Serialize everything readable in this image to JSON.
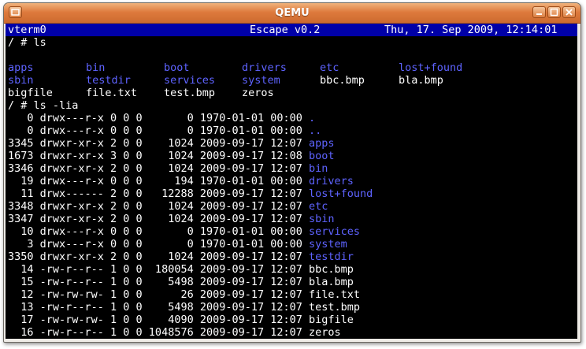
{
  "window": {
    "title": "QEMU"
  },
  "status": {
    "left": "vterm0",
    "center": "Escape v0.2",
    "right": "Thu, 17. Sep 2009, 12:14:01"
  },
  "colors": {
    "dir": "#5e63ff",
    "file": "#ffffff",
    "status_bg": "#0000a8",
    "title_bar": "#de7a3d"
  },
  "cmd1": "/ # ls",
  "ls_rows": [
    [
      {
        "t": "apps",
        "k": "dir"
      },
      {
        "t": "bin",
        "k": "dir"
      },
      {
        "t": "boot",
        "k": "dir"
      },
      {
        "t": "drivers",
        "k": "dir"
      },
      {
        "t": "etc",
        "k": "dir"
      },
      {
        "t": "lost+found",
        "k": "dir"
      }
    ],
    [
      {
        "t": "sbin",
        "k": "dir"
      },
      {
        "t": "testdir",
        "k": "dir"
      },
      {
        "t": "services",
        "k": "dir"
      },
      {
        "t": "system",
        "k": "dir"
      },
      {
        "t": "bbc.bmp",
        "k": "file"
      },
      {
        "t": "bla.bmp",
        "k": "file"
      }
    ],
    [
      {
        "t": "bigfile",
        "k": "file"
      },
      {
        "t": "file.txt",
        "k": "file"
      },
      {
        "t": "test.bmp",
        "k": "file"
      },
      {
        "t": "zeros",
        "k": "file"
      }
    ]
  ],
  "cmd2": "/ # ls -lia",
  "lia_rows": [
    {
      "meta": "   0 drwx---r-x 0 0 0       0 1970-01-01 00:00",
      "name": ".",
      "k": "dir"
    },
    {
      "meta": "   0 drwx---r-x 0 0 0       0 1970-01-01 00:00",
      "name": "..",
      "k": "dir"
    },
    {
      "meta": "3345 drwxr-xr-x 2 0 0    1024 2009-09-17 12:07",
      "name": "apps",
      "k": "dir"
    },
    {
      "meta": "1673 drwxr-xr-x 3 0 0    1024 2009-09-17 12:08",
      "name": "boot",
      "k": "dir"
    },
    {
      "meta": "3346 drwxr-xr-x 2 0 0    1024 2009-09-17 12:07",
      "name": "bin",
      "k": "dir"
    },
    {
      "meta": "  19 drwx---r-x 0 0 0     194 1970-01-01 00:00",
      "name": "drivers",
      "k": "dir"
    },
    {
      "meta": "  11 drwx------ 2 0 0   12288 2009-09-17 12:07",
      "name": "lost+found",
      "k": "dir"
    },
    {
      "meta": "3348 drwxr-xr-x 2 0 0    1024 2009-09-17 12:07",
      "name": "etc",
      "k": "dir"
    },
    {
      "meta": "3347 drwxr-xr-x 2 0 0    1024 2009-09-17 12:07",
      "name": "sbin",
      "k": "dir"
    },
    {
      "meta": "  10 drwx---r-x 0 0 0       0 1970-01-01 00:00",
      "name": "services",
      "k": "dir"
    },
    {
      "meta": "   3 drwx---r-x 0 0 0       0 1970-01-01 00:00",
      "name": "system",
      "k": "dir"
    },
    {
      "meta": "3350 drwxr-xr-x 2 0 0    1024 2009-09-17 12:07",
      "name": "testdir",
      "k": "dir"
    },
    {
      "meta": "  14 -rw-r--r-- 1 0 0  180054 2009-09-17 12:07",
      "name": "bbc.bmp",
      "k": "file"
    },
    {
      "meta": "  15 -rw-r--r-- 1 0 0    5498 2009-09-17 12:07",
      "name": "bla.bmp",
      "k": "file"
    },
    {
      "meta": "  12 -rw-rw-rw- 1 0 0      26 2009-09-17 12:07",
      "name": "file.txt",
      "k": "file"
    },
    {
      "meta": "  13 -rw-r--r-- 1 0 0    5498 2009-09-17 12:07",
      "name": "test.bmp",
      "k": "file"
    },
    {
      "meta": "  17 -rw-rw-rw- 1 0 0    4090 2009-09-17 12:07",
      "name": "bigfile",
      "k": "file"
    },
    {
      "meta": "  16 -rw-r--r-- 1 0 0 1048576 2009-09-17 12:07",
      "name": "zeros",
      "k": "file"
    }
  ],
  "prompt": "/ # "
}
